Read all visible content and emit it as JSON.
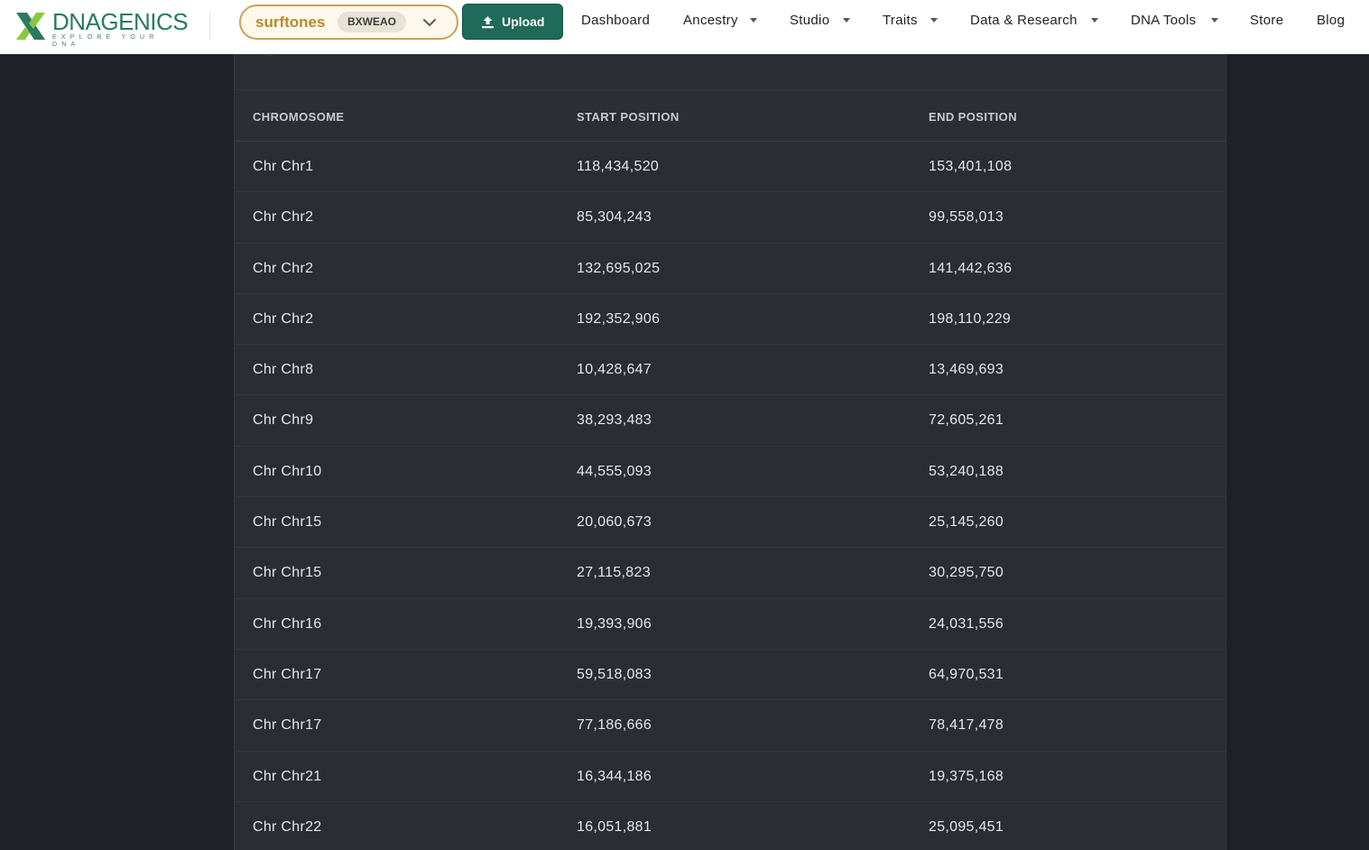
{
  "header": {
    "brand": "DNAGENICS",
    "tagline": "EXPLORE YOUR DNA",
    "profile": {
      "name": "surftones",
      "code": "BXWEAO"
    },
    "upload_label": "Upload",
    "nav": [
      {
        "label": "Dashboard"
      },
      {
        "label": "Ancestry"
      },
      {
        "label": "Studio"
      },
      {
        "label": "Traits"
      },
      {
        "label": "Data & Research"
      },
      {
        "label": "DNA Tools"
      },
      {
        "label": "Store"
      },
      {
        "label": "Blog"
      }
    ],
    "colors": {
      "brand": "#2a7a5e",
      "accent_gold": "#c9a256",
      "upload_bg": "#1f6a58"
    }
  },
  "table": {
    "columns": [
      "CHROMOSOME",
      "START POSITION",
      "END POSITION"
    ],
    "rows": [
      [
        "Chr Chr1",
        "118,434,520",
        "153,401,108"
      ],
      [
        "Chr Chr2",
        "85,304,243",
        "99,558,013"
      ],
      [
        "Chr Chr2",
        "132,695,025",
        "141,442,636"
      ],
      [
        "Chr Chr2",
        "192,352,906",
        "198,110,229"
      ],
      [
        "Chr Chr8",
        "10,428,647",
        "13,469,693"
      ],
      [
        "Chr Chr9",
        "38,293,483",
        "72,605,261"
      ],
      [
        "Chr Chr10",
        "44,555,093",
        "53,240,188"
      ],
      [
        "Chr Chr15",
        "20,060,673",
        "25,145,260"
      ],
      [
        "Chr Chr15",
        "27,115,823",
        "30,295,750"
      ],
      [
        "Chr Chr16",
        "19,393,906",
        "24,031,556"
      ],
      [
        "Chr Chr17",
        "59,518,083",
        "64,970,531"
      ],
      [
        "Chr Chr17",
        "77,186,666",
        "78,417,478"
      ],
      [
        "Chr Chr21",
        "16,344,186",
        "19,375,168"
      ],
      [
        "Chr Chr22",
        "16,051,881",
        "25,095,451"
      ]
    ]
  }
}
